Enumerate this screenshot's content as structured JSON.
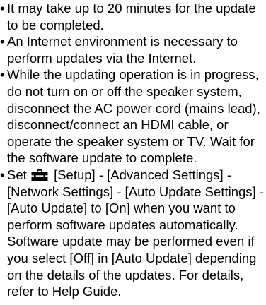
{
  "bullet_char": "•",
  "items": [
    {
      "text": "It may take up to 20 minutes for the update to be completed."
    },
    {
      "text": "An Internet environment is necessary to perform updates via the Internet."
    },
    {
      "text": "While the updating operation is in progress, do not turn on or off the speaker system, disconnect the AC power cord (mains lead), disconnect/connect an HDMI cable, or operate the speaker system or TV. Wait for the software update to complete."
    },
    {
      "text_before_icon": "Set",
      "icon": "toolbox-icon",
      "text_after_icon": "[Setup] - [Advanced Settings] - [Network Settings] - [Auto Update Settings] - [Auto Update] to [On] when you want to perform software updates automatically. Software update may be performed even if you select [Off] in [Auto Update] depending on the details of the updates. For details, refer to Help Guide."
    }
  ]
}
